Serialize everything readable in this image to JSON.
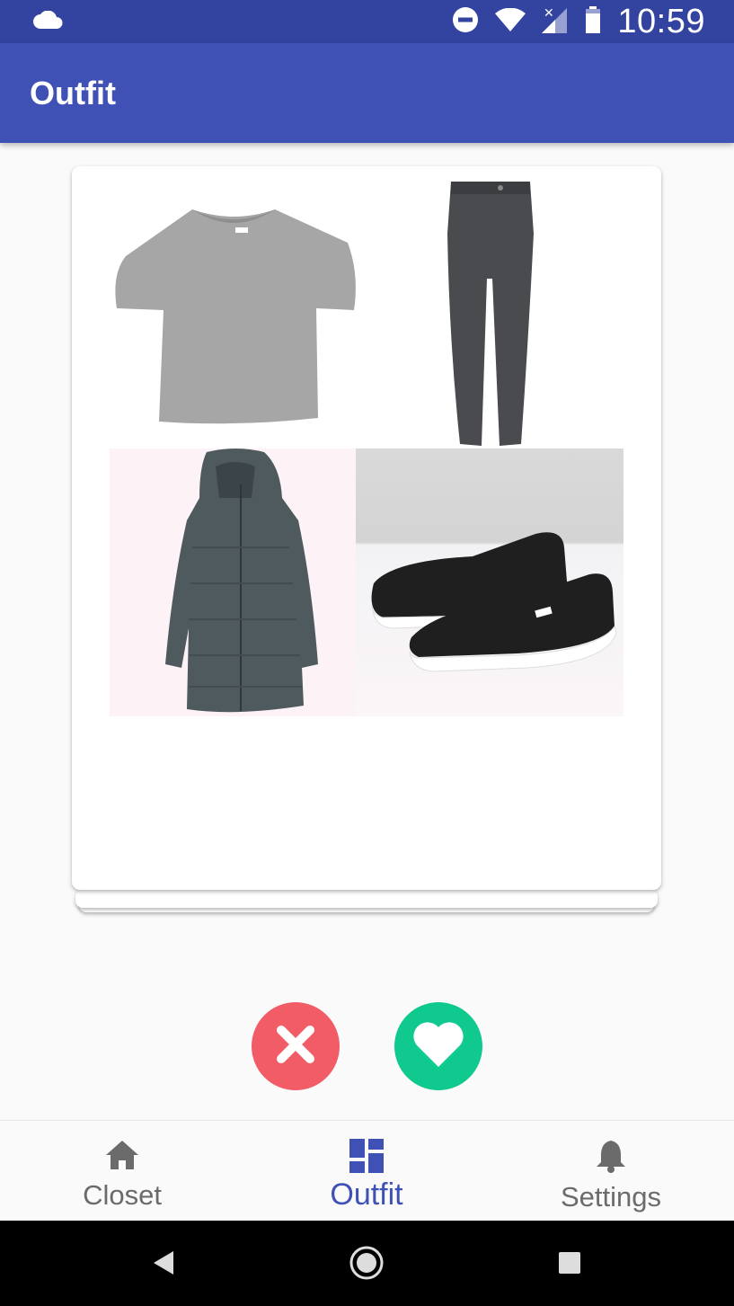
{
  "status_bar": {
    "time": "10:59",
    "icons": [
      "cloud-icon",
      "do-not-disturb-icon",
      "wifi-icon",
      "signal-icon",
      "battery-icon"
    ]
  },
  "app_bar": {
    "title": "Outfit"
  },
  "outfit_card": {
    "items": [
      {
        "name": "tshirt-image",
        "description_icon": "gray t-shirt"
      },
      {
        "name": "pants-image",
        "description_icon": "gray pants"
      },
      {
        "name": "coat-image",
        "description_icon": "gray puffer coat"
      },
      {
        "name": "shoes-image",
        "description_icon": "black slip-on sneakers"
      }
    ]
  },
  "actions": {
    "dislike_icon": "close-icon",
    "like_icon": "heart-icon",
    "dislike_color": "#f25c66",
    "like_color": "#10c98f"
  },
  "bottom_nav": {
    "items": [
      {
        "label": "Closet",
        "icon": "home-icon",
        "active": false
      },
      {
        "label": "Outfit",
        "icon": "dashboard-icon",
        "active": true
      },
      {
        "label": "Settings",
        "icon": "bell-icon",
        "active": false
      }
    ]
  },
  "colors": {
    "primary": "#3f51b5",
    "primary_dark": "#3243a0",
    "background": "#fafafa"
  }
}
